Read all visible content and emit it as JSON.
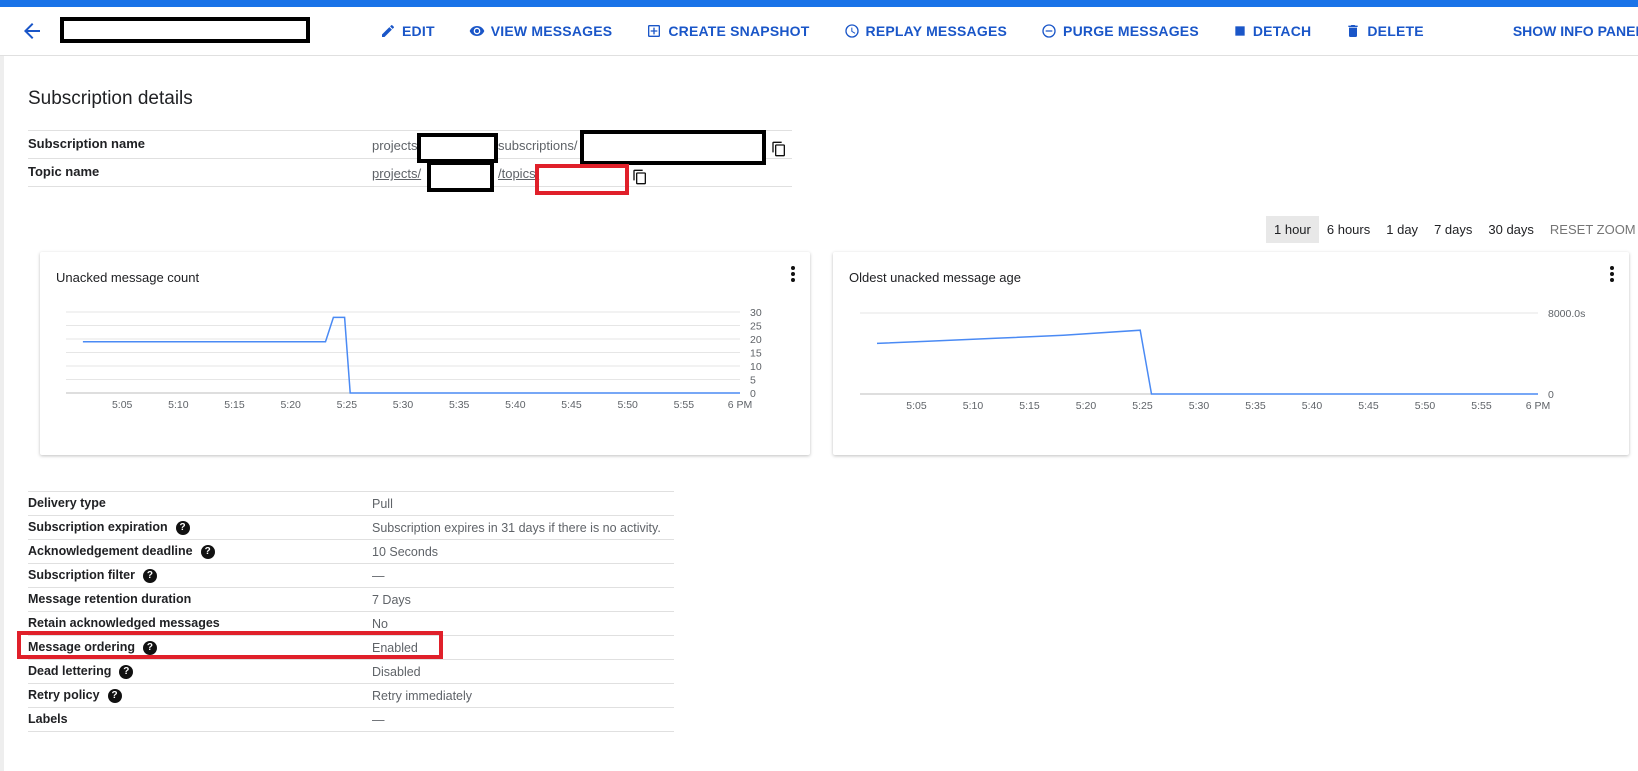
{
  "header": {
    "actions": {
      "edit": "EDIT",
      "view_messages": "VIEW MESSAGES",
      "create_snapshot": "CREATE SNAPSHOT",
      "replay_messages": "REPLAY MESSAGES",
      "purge_messages": "PURGE MESSAGES",
      "detach": "DETACH",
      "delete": "DELETE"
    },
    "show_info_panel": "SHOW INFO PANEL"
  },
  "page_title": "Subscription details",
  "summary": {
    "subscription_name_label": "Subscription name",
    "subscription_prefix": "projects",
    "subscription_mid": "subscriptions/",
    "topic_name_label": "Topic name",
    "topic_prefix": "projects/",
    "topic_mid": "/topics/"
  },
  "time_ranges": [
    "1 hour",
    "6 hours",
    "1 day",
    "7 days",
    "30 days"
  ],
  "selected_range": "1 hour",
  "reset_zoom": "RESET ZOOM",
  "colors": {
    "accent": "#1a56c8",
    "line": "#4a8af4",
    "highlight": "#e0202a"
  },
  "chart_data": [
    {
      "type": "line",
      "title": "Unacked message count",
      "x_ticks": [
        "5:05",
        "5:10",
        "5:15",
        "5:20",
        "5:25",
        "5:30",
        "5:35",
        "5:40",
        "5:45",
        "5:50",
        "5:55",
        "6 PM"
      ],
      "y_ticks": [
        "30",
        "25",
        "20",
        "15",
        "10",
        "5",
        "0"
      ],
      "ylim": [
        0,
        30
      ],
      "x_minutes": [
        0,
        25,
        35
      ],
      "series": [
        {
          "points": [
            [
              1.5,
              19
            ],
            [
              23.1,
              19
            ],
            [
              23.8,
              28
            ],
            [
              24.8,
              28
            ],
            [
              25.3,
              0
            ],
            [
              60,
              0
            ]
          ]
        }
      ]
    },
    {
      "type": "line",
      "title": "Oldest unacked message age",
      "x_ticks": [
        "5:05",
        "5:10",
        "5:15",
        "5:20",
        "5:25",
        "5:30",
        "5:35",
        "5:40",
        "5:45",
        "5:50",
        "5:55",
        "6 PM"
      ],
      "y_ticks": [
        "8000.0s",
        "0"
      ],
      "ylim": [
        0,
        8000
      ],
      "series": [
        {
          "points": [
            [
              1.5,
              5000
            ],
            [
              6,
              5200
            ],
            [
              12,
              5500
            ],
            [
              18,
              5800
            ],
            [
              24.8,
              6300
            ],
            [
              25.8,
              0
            ],
            [
              60,
              0
            ]
          ]
        }
      ]
    }
  ],
  "details": [
    {
      "label": "Delivery type",
      "value": "Pull",
      "help": false
    },
    {
      "label": "Subscription expiration",
      "value": "Subscription expires in 31 days if there is no activity.",
      "help": true
    },
    {
      "label": "Acknowledgement deadline",
      "value": "10 Seconds",
      "help": true
    },
    {
      "label": "Subscription filter",
      "value": "—",
      "help": true
    },
    {
      "label": "Message retention duration",
      "value": "7 Days",
      "help": false
    },
    {
      "label": "Retain acknowledged messages",
      "value": "No",
      "help": false
    },
    {
      "label": "Message ordering",
      "value": "Enabled",
      "help": true
    },
    {
      "label": "Dead lettering",
      "value": "Disabled",
      "help": true
    },
    {
      "label": "Retry policy",
      "value": "Retry immediately",
      "help": true
    },
    {
      "label": "Labels",
      "value": "—",
      "help": false
    }
  ],
  "help_glyph": "?"
}
